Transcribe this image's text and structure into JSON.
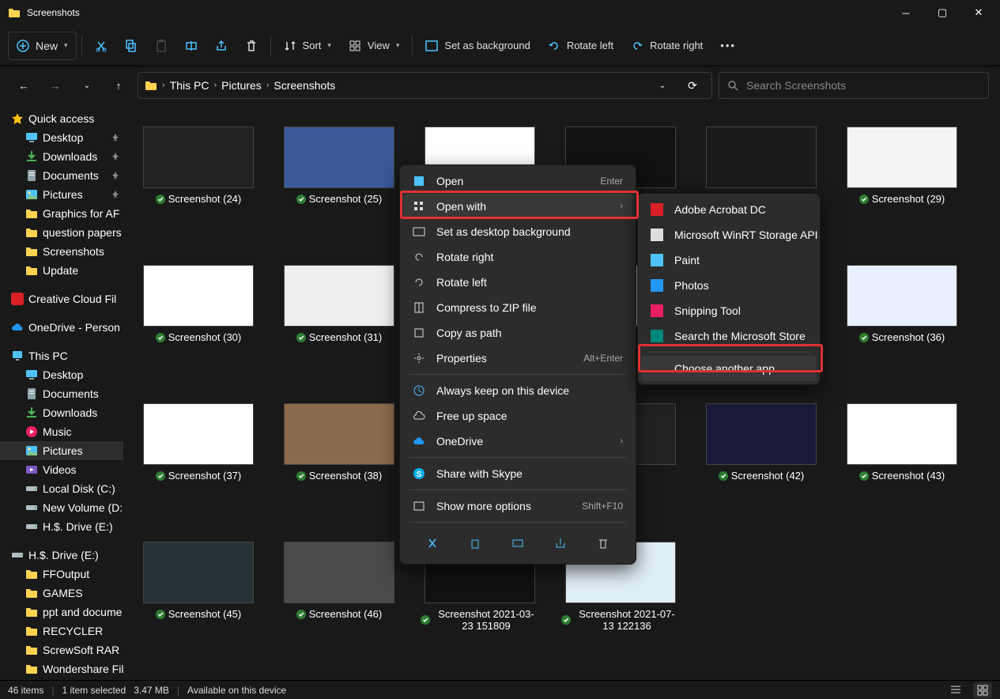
{
  "window": {
    "title": "Screenshots"
  },
  "toolbar": {
    "new": "New",
    "sort": "Sort",
    "view": "View",
    "set_bg": "Set as background",
    "rotate_left": "Rotate left",
    "rotate_right": "Rotate right"
  },
  "breadcrumbs": [
    "This PC",
    "Pictures",
    "Screenshots"
  ],
  "search": {
    "placeholder": "Search Screenshots"
  },
  "sidebar": {
    "quick_access": "Quick access",
    "quick_items": [
      {
        "label": "Desktop",
        "icon": "desktop",
        "pin": true
      },
      {
        "label": "Downloads",
        "icon": "download",
        "pin": true
      },
      {
        "label": "Documents",
        "icon": "document",
        "pin": true
      },
      {
        "label": "Pictures",
        "icon": "picture",
        "pin": true
      },
      {
        "label": "Graphics for AF",
        "icon": "folder",
        "pin": false
      },
      {
        "label": "question papers",
        "icon": "folder",
        "pin": false
      },
      {
        "label": "Screenshots",
        "icon": "folder",
        "pin": false
      },
      {
        "label": "Update",
        "icon": "folder",
        "pin": false
      }
    ],
    "creative_cloud": "Creative Cloud Fil",
    "onedrive": "OneDrive - Person",
    "this_pc": "This PC",
    "pc_items": [
      {
        "label": "Desktop",
        "icon": "desktop"
      },
      {
        "label": "Documents",
        "icon": "document"
      },
      {
        "label": "Downloads",
        "icon": "download"
      },
      {
        "label": "Music",
        "icon": "music"
      },
      {
        "label": "Pictures",
        "icon": "picture",
        "selected": true
      },
      {
        "label": "Videos",
        "icon": "video"
      },
      {
        "label": "Local Disk (C:)",
        "icon": "disk"
      },
      {
        "label": "New Volume (D:",
        "icon": "disk"
      },
      {
        "label": "H.$. Drive (E:)",
        "icon": "disk"
      }
    ],
    "drive_e": "H.$. Drive (E:)",
    "drive_e_items": [
      {
        "label": "FFOutput"
      },
      {
        "label": "GAMES"
      },
      {
        "label": "ppt and docume"
      },
      {
        "label": "RECYCLER"
      },
      {
        "label": "ScrewSoft RAR F"
      },
      {
        "label": "Wondershare Fil"
      }
    ]
  },
  "files": [
    {
      "name": "Screenshot (24)",
      "bg": "#222"
    },
    {
      "name": "Screenshot (25)",
      "bg": "#3a5a9a"
    },
    {
      "name": "",
      "bg": "#fff",
      "hidden": true
    },
    {
      "name": "",
      "bg": "#111",
      "hidden": true
    },
    {
      "name": "",
      "bg": "#1b1b1b",
      "hidden": true
    },
    {
      "name": "Screenshot (29)",
      "bg": "#f3f3f3"
    },
    {
      "name": "Screenshot (30)",
      "bg": "#fff"
    },
    {
      "name": "Screenshot (31)",
      "bg": "#eee"
    },
    {
      "name": "",
      "bg": "#fff",
      "hidden": true
    },
    {
      "name": "",
      "bg": "#fff",
      "hidden": true
    },
    {
      "name": "",
      "bg": "#fff",
      "hidden": true
    },
    {
      "name": "Screenshot (36)",
      "bg": "#e8f0ff"
    },
    {
      "name": "Screenshot (37)",
      "bg": "#fff"
    },
    {
      "name": "Screenshot (38)",
      "bg": "#8a6a4a"
    },
    {
      "name": "",
      "bg": "#fff",
      "hidden": true
    },
    {
      "name": "",
      "bg": "#222",
      "hidden": true
    },
    {
      "name": "Screenshot (42)",
      "bg": "#1a1a3a"
    },
    {
      "name": "Screenshot (43)",
      "bg": "#fff"
    },
    {
      "name": "Screenshot (45)",
      "bg": "#263238"
    },
    {
      "name": "Screenshot (46)",
      "bg": "#4a4a4a"
    },
    {
      "name": "Screenshot 2021-03-23 151809",
      "bg": "#111"
    },
    {
      "name": "Screenshot 2021-07-13 122136",
      "bg": "#e0eef8"
    },
    {
      "name": "",
      "bg": "",
      "empty": true
    },
    {
      "name": "",
      "bg": "",
      "empty": true
    }
  ],
  "context_menu": {
    "open": "Open",
    "open_short": "Enter",
    "open_with": "Open with",
    "set_bg": "Set as desktop background",
    "rotate_right": "Rotate right",
    "rotate_left": "Rotate left",
    "compress": "Compress to ZIP file",
    "copy_path": "Copy as path",
    "properties": "Properties",
    "properties_short": "Alt+Enter",
    "keep_device": "Always keep on this device",
    "free_space": "Free up space",
    "onedrive": "OneDrive",
    "skype": "Share with Skype",
    "show_more": "Show more options",
    "show_more_short": "Shift+F10"
  },
  "open_with_menu": {
    "adobe": "Adobe Acrobat DC",
    "winrt": "Microsoft WinRT Storage API",
    "paint": "Paint",
    "photos": "Photos",
    "snip": "Snipping Tool",
    "store": "Search the Microsoft Store",
    "choose": "Choose another app"
  },
  "status": {
    "count": "46 items",
    "selected": "1 item selected",
    "size": "3.47 MB",
    "location": "Available on this device"
  }
}
